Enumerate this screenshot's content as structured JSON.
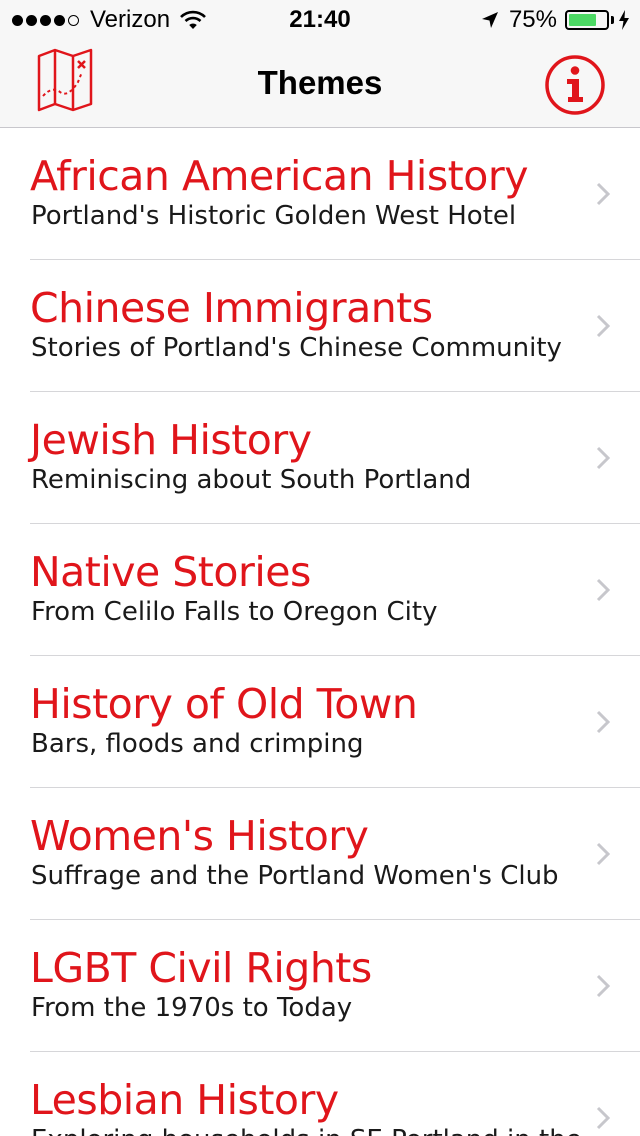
{
  "status_bar": {
    "carrier": "Verizon",
    "time": "21:40",
    "battery_percent_label": "75%",
    "battery_level": 0.75,
    "battery_color": "#4cd964",
    "signal_bars_filled": 4,
    "signal_bars_total": 5,
    "icons": [
      "wifi-icon",
      "location-arrow-icon",
      "battery-icon",
      "charging-bolt-icon"
    ]
  },
  "nav_bar": {
    "title": "Themes",
    "left_icon": "map-icon",
    "right_icon": "info-icon",
    "accent_color": "#e0151b"
  },
  "themes": [
    {
      "title": "African American History",
      "subtitle": "Portland's Historic Golden West Hotel"
    },
    {
      "title": "Chinese Immigrants",
      "subtitle": "Stories of Portland's Chinese Community"
    },
    {
      "title": "Jewish History",
      "subtitle": "Reminiscing about South Portland"
    },
    {
      "title": "Native Stories",
      "subtitle": "From Celilo Falls to Oregon City"
    },
    {
      "title": "History of Old Town",
      "subtitle": "Bars, floods and crimping"
    },
    {
      "title": "Women's History",
      "subtitle": "Suffrage and the Portland Women's Club"
    },
    {
      "title": "LGBT Civil Rights",
      "subtitle": "From the 1970s to Today"
    },
    {
      "title": "Lesbian History",
      "subtitle": "Exploring households in SE Portland in the"
    }
  ],
  "colors": {
    "title_red": "#e0151b",
    "subtitle_text": "#1a1a1a",
    "separator": "#d6d6d9",
    "chevron": "#c7c7cc",
    "bar_background": "#f7f7f7"
  }
}
